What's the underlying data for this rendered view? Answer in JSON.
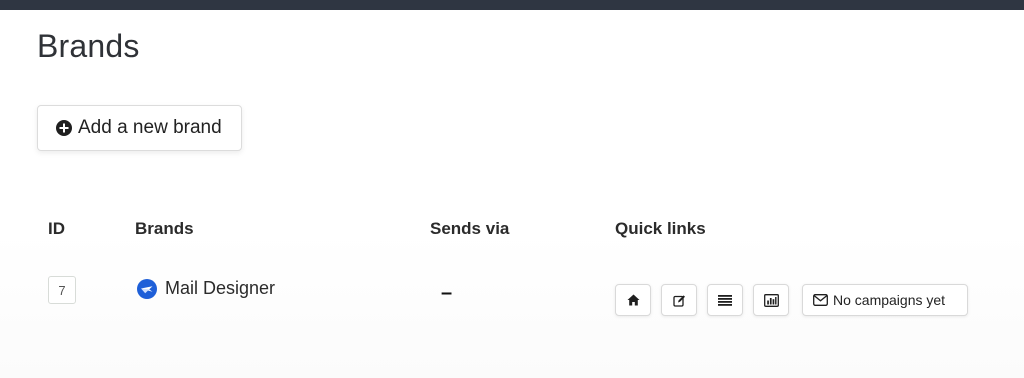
{
  "page": {
    "title": "Brands"
  },
  "actions": {
    "add_brand_label": "Add a new brand",
    "add_icon": "plus-circle-icon"
  },
  "table": {
    "headers": {
      "id": "ID",
      "brands": "Brands",
      "sends_via": "Sends via",
      "quick_links": "Quick links"
    },
    "rows": [
      {
        "id": "7",
        "brand": "Mail Designer",
        "brand_icon": "mail-designer-logo-icon",
        "sends_via": "–",
        "quick_links": {
          "icons": [
            "home-icon",
            "edit-icon",
            "list-icon",
            "bar-chart-icon"
          ],
          "campaigns_label": "No campaigns yet",
          "campaigns_icon": "envelope-icon"
        }
      }
    ]
  },
  "colors": {
    "topbar": "#2f3642",
    "brand_logo": "#1e5fd8"
  }
}
